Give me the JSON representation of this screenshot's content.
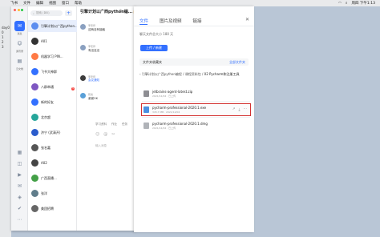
{
  "menubar": {
    "items": [
      "飞书",
      "文件",
      "编辑",
      "视图",
      "窗口",
      "帮助"
    ],
    "clock": "周四 下午1:13"
  },
  "desktop": {
    "side_text": [
      "day0",
      "0",
      "1",
      "2",
      "3"
    ]
  },
  "rail": {
    "dot_colors": [
      "#ff5f57",
      "#febc2e",
      "#28c840"
    ],
    "items": [
      {
        "icon": "chat-icon",
        "label": "消息",
        "active": true,
        "badge": "3"
      },
      {
        "icon": "contacts-icon",
        "label": "通讯录",
        "active": false,
        "badge": ""
      },
      {
        "icon": "docs-icon",
        "label": "云文档",
        "active": false,
        "badge": ""
      }
    ]
  },
  "search": {
    "placeholder": "搜索 (⌘K)",
    "add": "+"
  },
  "chats": [
    {
      "name": "引擎计划以广西python...",
      "sub": "",
      "time": "",
      "badge": "",
      "color": "#5b8def",
      "selected": true
    },
    {
      "name": "A01",
      "sub": "",
      "time": "",
      "badge": "",
      "color": "#333",
      "selected": false
    },
    {
      "name": "机器学习 PIN...",
      "sub": "",
      "time": "",
      "badge": "",
      "color": "#ff7a45",
      "selected": false
    },
    {
      "name": "飞书大神群",
      "sub": "",
      "time": "",
      "badge": "",
      "color": "#3370ff",
      "selected": false
    },
    {
      "name": "八群串通",
      "sub": "",
      "time": "",
      "badge": "5",
      "color": "#7e57c2",
      "selected": false
    },
    {
      "name": "新的好友",
      "sub": "",
      "time": "",
      "badge": "",
      "color": "#3370ff",
      "selected": false
    },
    {
      "name": "北京超",
      "sub": "",
      "time": "",
      "badge": "",
      "color": "#26a69a",
      "selected": false
    },
    {
      "name": "济宁 (武清开)",
      "sub": "",
      "time": "",
      "badge": "",
      "color": "#2b5ccc",
      "selected": false
    },
    {
      "name": "张名嘉",
      "sub": "",
      "time": "",
      "badge": "",
      "color": "#555",
      "selected": false
    },
    {
      "name": "A02",
      "sub": "",
      "time": "",
      "badge": "",
      "color": "#444",
      "selected": false
    },
    {
      "name": "广西直播...",
      "sub": "",
      "time": "",
      "badge": "",
      "color": "#43a047",
      "selected": false
    },
    {
      "name": "张洋",
      "sub": "",
      "time": "",
      "badge": "",
      "color": "#607d8b",
      "selected": false
    },
    {
      "name": "美团招聘",
      "sub": "",
      "time": "",
      "badge": "",
      "color": "#666",
      "selected": false
    }
  ],
  "conversation": {
    "title": "引擎计划以广西python编...",
    "tag": "外部",
    "messages": [
      {
        "name": "李老师",
        "text": "这两没有接触"
      },
      {
        "name": "李老师",
        "text": "有没没没",
        "extra": ""
      },
      {
        "name": "李老师",
        "text": "",
        "link": "会议通知"
      },
      {
        "name": "乾峰",
        "text": "谢谢OK"
      }
    ],
    "tabs": [
      "学习资料",
      "作业",
      "任务",
      "目录"
    ],
    "reply_hint": "输入消息"
  },
  "files_panel": {
    "tabs": [
      "文件",
      "图片及视频",
      "链接"
    ],
    "info": "聊天文件总大小 180 天",
    "upload": "上传 / 新建",
    "section": "文件夹收藏夹",
    "section_all": "全部文件夹",
    "breadcrumb": [
      "引擎计划以广西python编程",
      "课程资料包",
      "02 Pycharm和注册工具"
    ],
    "files": [
      {
        "name": "jetbrains-agent-latest.zip",
        "meta": "2021/12/04 · 已上传",
        "color": "#8e8e93",
        "highlighted": false
      },
      {
        "name": "pycharm-professional-2020.1.exe",
        "meta": "345.7 MB · 2021/12/04",
        "color": "#4a90e2",
        "highlighted": true
      },
      {
        "name": "pycharm-professional-2020.1.dmg",
        "meta": "2021/12/04 · 已上传",
        "color": "#b0b3b8",
        "highlighted": false
      }
    ]
  }
}
